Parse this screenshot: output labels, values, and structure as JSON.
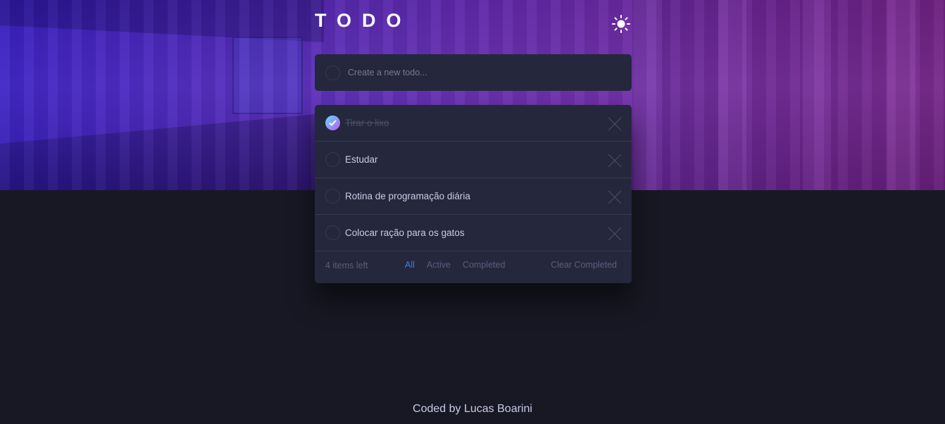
{
  "header": {
    "title": "TODO",
    "theme_icon": "sun-icon"
  },
  "new_todo": {
    "placeholder": "Create a new todo..."
  },
  "todos": [
    {
      "text": "Tirar o lixo",
      "completed": true
    },
    {
      "text": "Estudar",
      "completed": false
    },
    {
      "text": "Rotina de programação diária",
      "completed": false
    },
    {
      "text": "Colocar ração para os gatos",
      "completed": false
    }
  ],
  "footer": {
    "items_left": "4 items left",
    "filters": [
      "All",
      "Active",
      "Completed"
    ],
    "active_filter": "All",
    "clear_label": "Clear Completed"
  },
  "credit": "Coded by Lucas Boarini",
  "colors": {
    "accent": "#3a7cfd",
    "card_bg": "#25273c",
    "page_bg": "#181824",
    "check_gradient_start": "#57ddff",
    "check_gradient_end": "#c058f3"
  }
}
